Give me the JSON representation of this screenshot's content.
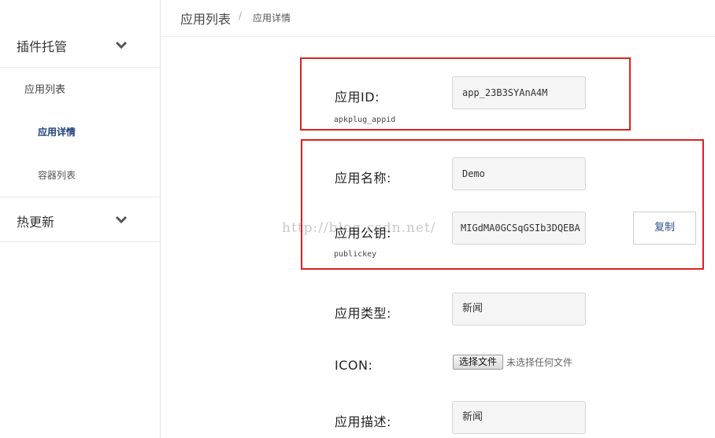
{
  "sidebar": {
    "group1": {
      "label": "插件托管",
      "icon": "chevron-down-icon"
    },
    "group1_items": [
      {
        "label": "应用列表"
      },
      {
        "label": "应用详情"
      },
      {
        "label": "容器列表"
      }
    ],
    "group2": {
      "label": "热更新",
      "icon": "chevron-down-icon"
    }
  },
  "breadcrumb": {
    "main": "应用列表",
    "separator": "/",
    "current": "应用详情"
  },
  "form": {
    "app_id": {
      "label": "应用ID:",
      "hint": "apkplug_appid",
      "value": "app_23B3SYAnA4M"
    },
    "app_name": {
      "label": "应用名称:",
      "value": "Demo"
    },
    "public_key": {
      "label": "应用公钥:",
      "hint": "publickey",
      "value": "MIGdMA0GCSqGSIb3DQEBA",
      "copy_label": "复制"
    },
    "app_type": {
      "label": "应用类型:",
      "value": "新闻"
    },
    "icon": {
      "label": "ICON:",
      "file_button": "选择文件",
      "file_status": "未选择任何文件"
    },
    "app_desc": {
      "label": "应用描述:",
      "value": "新闻"
    }
  },
  "watermark": "http://blog.csdn.net/",
  "colors": {
    "highlight_border": "#e02020",
    "active_nav": "#1f3f7a",
    "input_bg": "#f5f5f5"
  }
}
